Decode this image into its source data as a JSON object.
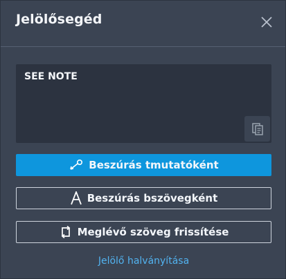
{
  "header": {
    "title": "Jelölősegéd"
  },
  "note": {
    "text": "SEE NOTE"
  },
  "buttons": {
    "insert_leader": "Beszúrás tmutatóként",
    "insert_text": "Beszúrás bszövegként",
    "refresh_text": "Meglévő szöveg frissítése"
  },
  "link": {
    "fade_label": "Jelölő halványítása"
  },
  "icons": {
    "close": "close-icon",
    "copy": "copy-icon",
    "leader": "leader-icon",
    "text": "text-icon",
    "refresh": "refresh-icon"
  },
  "colors": {
    "background": "#3b4453",
    "note_background": "#2c3340",
    "primary": "#0e96dd",
    "link": "#52b3f0"
  }
}
